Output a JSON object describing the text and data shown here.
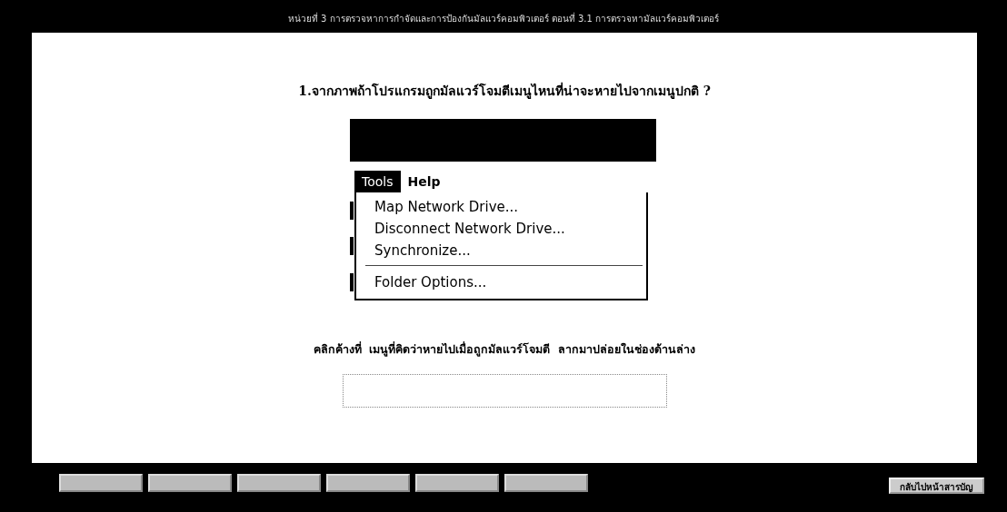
{
  "header": {
    "title": "หน่วยที่ 3 การตรวจหาการกำจัดและการป้องกันมัลแวร์คอมพิวเตอร์ ตอนที่ 3.1 การตรวจหามัลแวร์คอมพิวเตอร์"
  },
  "question": "1.จากภาพถ้าโปรแกรมถูกมัลแวร์โจมตีเมนูไหนที่น่าจะหายไปจากเมนูปกติ ?",
  "menubar": [
    {
      "label": "Tools",
      "selected": true
    },
    {
      "label": "Help",
      "selected": false
    }
  ],
  "menu_items": [
    {
      "label": "Map Network Drive...",
      "kind": "item"
    },
    {
      "label": "Disconnect Network Drive...",
      "kind": "item"
    },
    {
      "label": "Synchronize...",
      "kind": "item"
    },
    {
      "kind": "separator"
    },
    {
      "label": "Folder Options...",
      "kind": "item"
    }
  ],
  "instruction": "คลิกค้างที่  เมนูที่คิดว่าหายไปเมื่อถูกมัลแวร์โจมตี  ลากมาปล่อยในช่องด้านล่าง",
  "nav_buttons_count_shown": [
    {
      "kind": "blank"
    },
    {
      "kind": "blank"
    },
    {
      "kind": "blank"
    },
    {
      "kind": "blank"
    },
    {
      "kind": "blank"
    },
    {
      "kind": "blank"
    }
  ],
  "back_button": "กลับไปหน้าสารบัญ"
}
